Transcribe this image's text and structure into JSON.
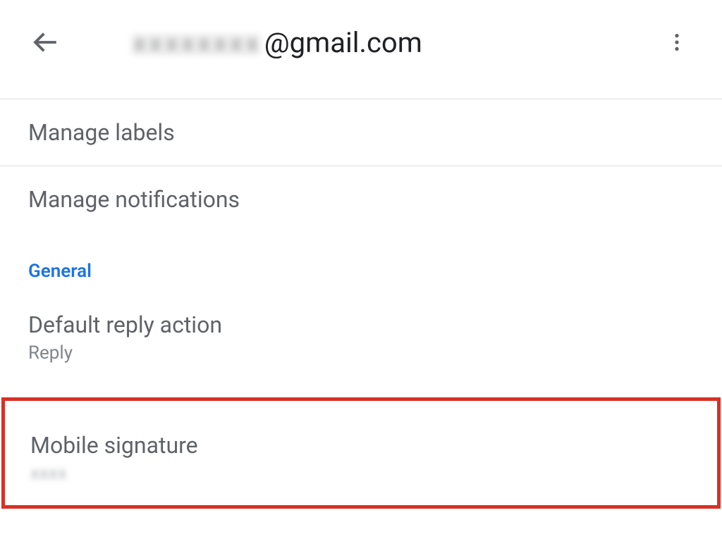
{
  "header": {
    "title_prefix_blurred": "xxxxxxxx",
    "title_suffix": "@gmail.com"
  },
  "items": {
    "manage_labels": "Manage labels",
    "manage_notifications": "Manage notifications"
  },
  "sections": {
    "general": "General"
  },
  "settings": {
    "default_reply_action": {
      "title": "Default reply action",
      "value": "Reply"
    },
    "mobile_signature": {
      "title": "Mobile signature",
      "value_blurred": "xxxx"
    }
  }
}
